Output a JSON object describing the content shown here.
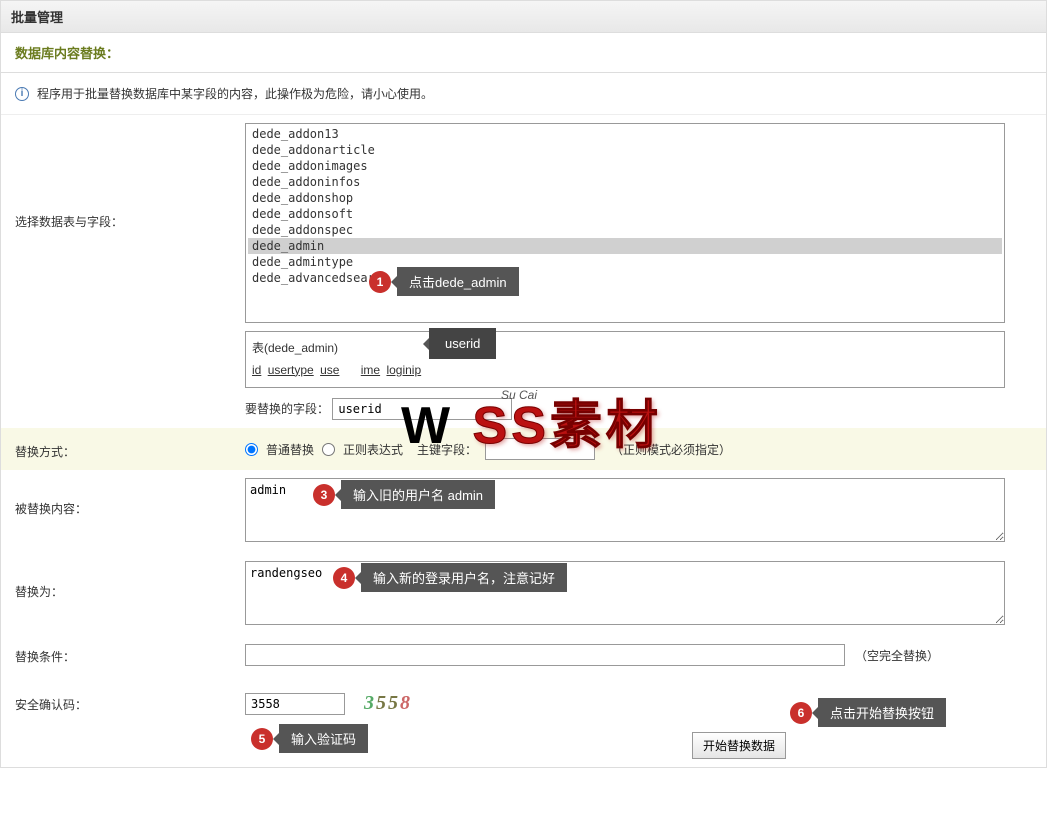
{
  "header": {
    "title": "批量管理"
  },
  "section": {
    "title": "数据库内容替换："
  },
  "info": {
    "text": "程序用于批量替换数据库中某字段的内容，此操作极为危险，请小心使用。"
  },
  "labels": {
    "select_table": "选择数据表与字段：",
    "table_name": "表(dede_admin)",
    "replace_field": "要替换的字段：",
    "replace_method": "替换方式：",
    "method_normal": "普通替换",
    "method_regex": "正则表达式",
    "key_field": "主键字段：",
    "regex_hint": "（正则模式必须指定）",
    "replaced_content": "被替换内容：",
    "replace_to": "替换为：",
    "replace_cond": "替换条件：",
    "cond_hint": "（空完全替换）",
    "security_code": "安全确认码：",
    "submit": "开始替换数据"
  },
  "tables": [
    "dede_addon13",
    "dede_addonarticle",
    "dede_addonimages",
    "dede_addoninfos",
    "dede_addonshop",
    "dede_addonsoft",
    "dede_addonspec",
    "dede_admin",
    "dede_admintype",
    "dede_advancedsearch"
  ],
  "selected_table": "dede_admin",
  "fields": [
    "id",
    "usertype",
    "use",
    "",
    "",
    "",
    "",
    "",
    "ime",
    "loginip"
  ],
  "values": {
    "replace_field": "userid",
    "replaced_content": "admin",
    "replace_to": "randengseo",
    "security_code": "3558",
    "captcha": "3558"
  },
  "annotations": {
    "a1": "点击dede_admin",
    "a2": "userid",
    "a3": "输入旧的用户名 admin",
    "a4": "输入新的登录用户名，注意记好",
    "a5": "输入验证码",
    "a6": "点击开始替换按钮"
  },
  "watermark": {
    "w": "W",
    "ss": "SS素材",
    "sub": "Su Cai"
  }
}
